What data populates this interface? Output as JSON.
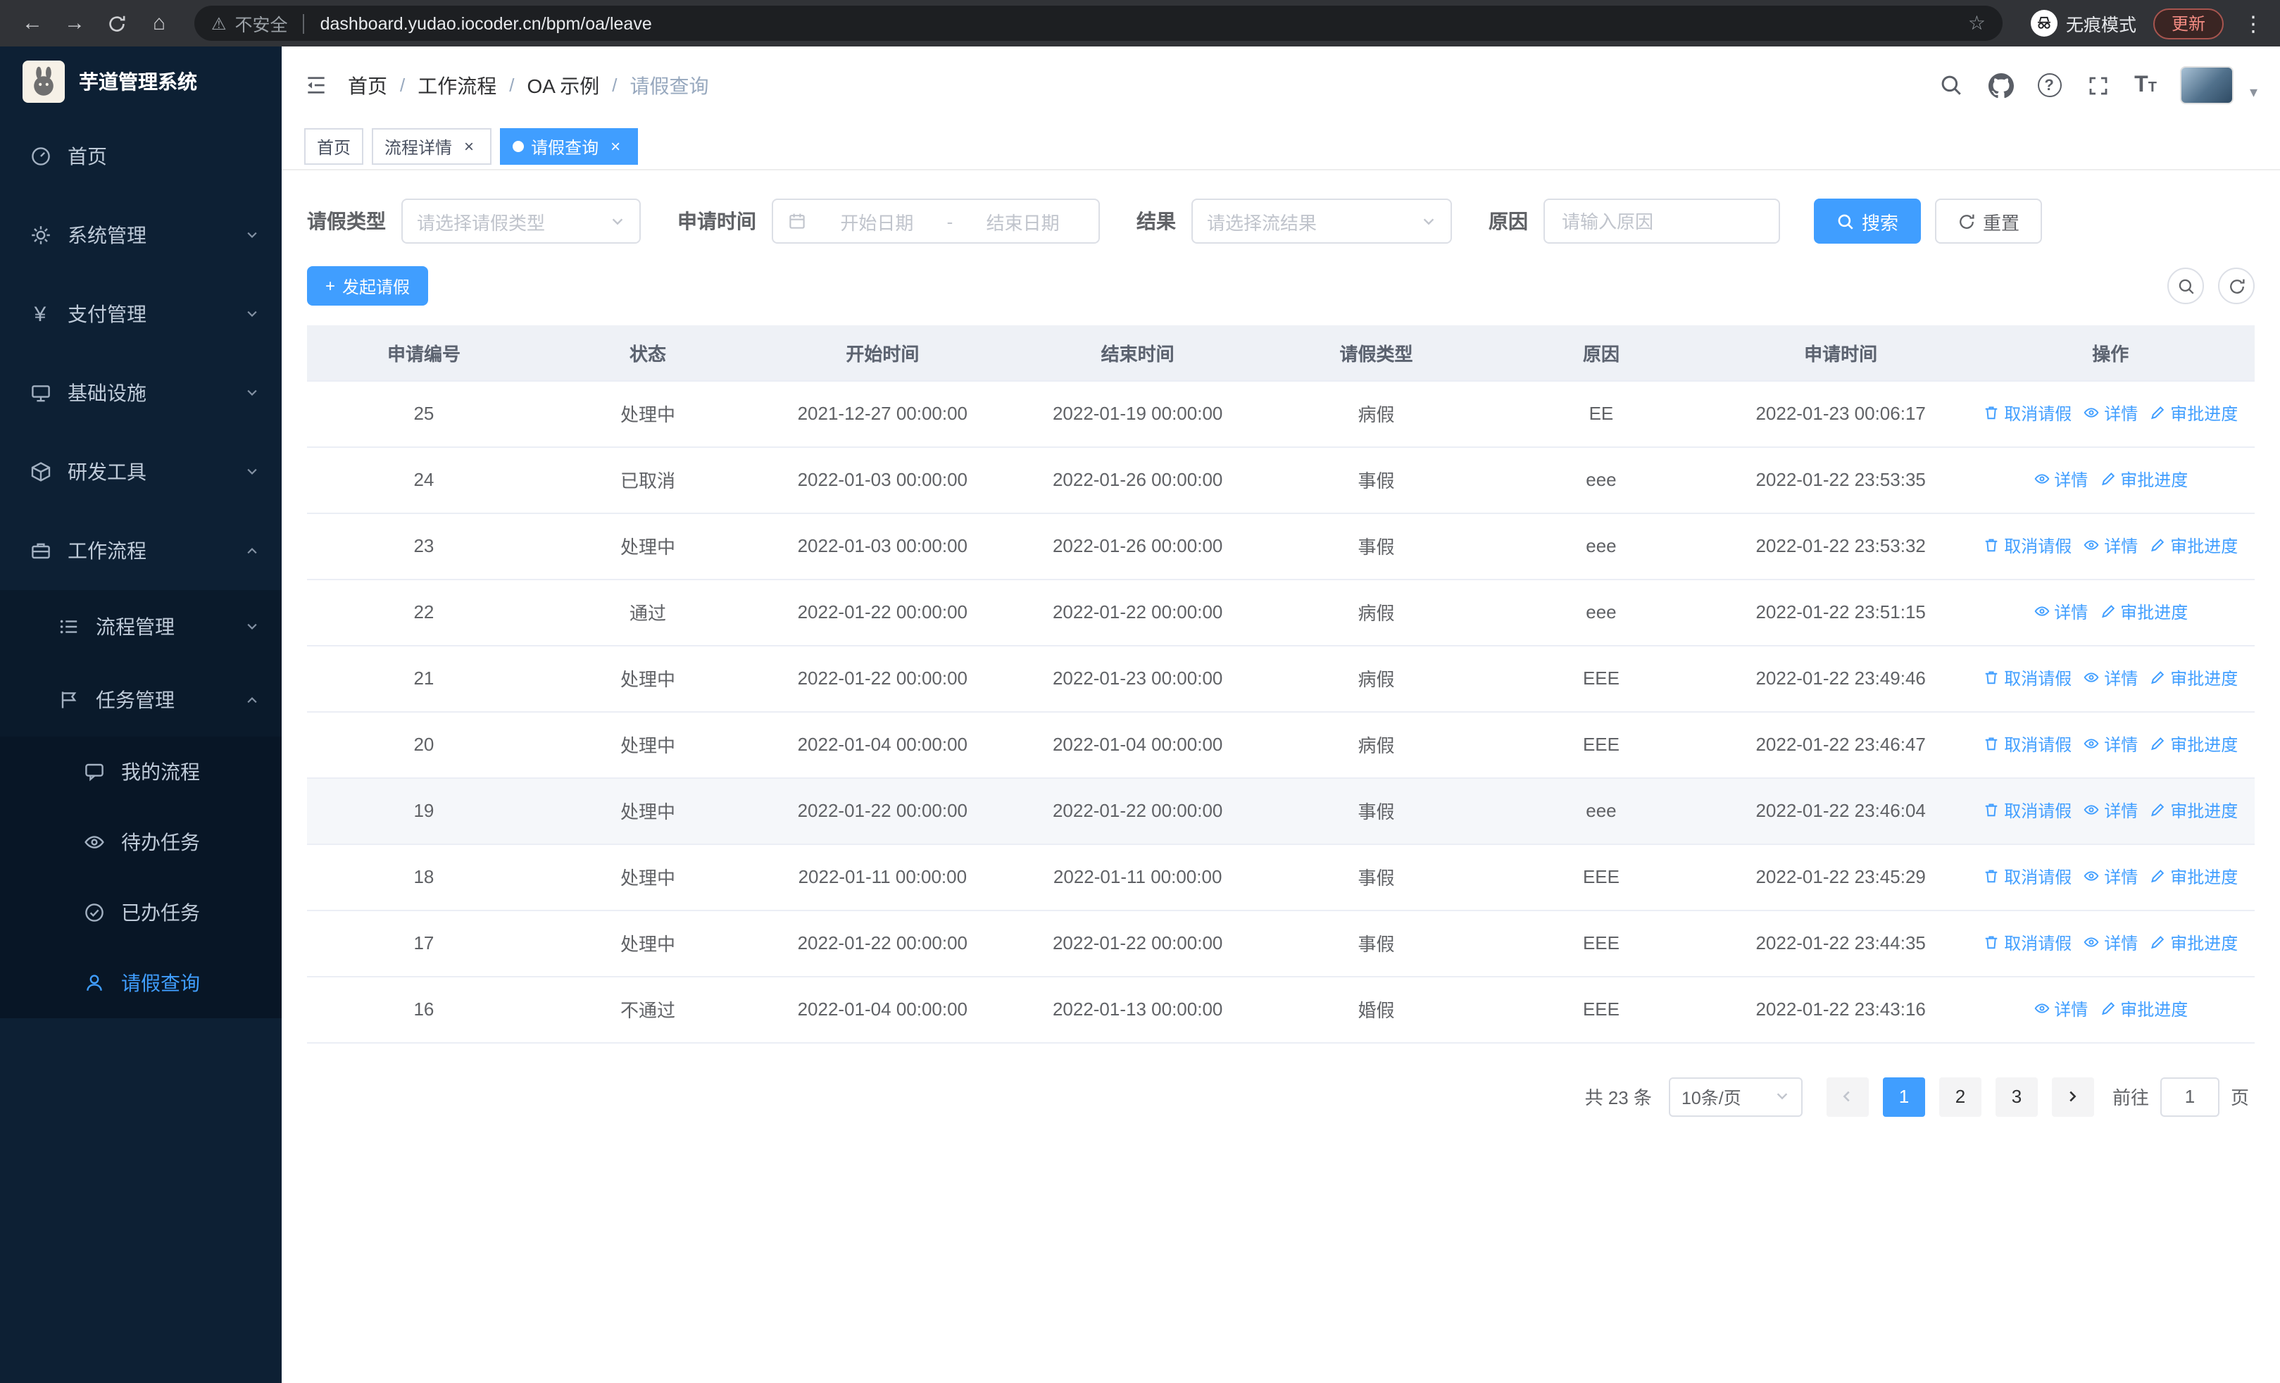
{
  "browser": {
    "security_label": "不安全",
    "url": "dashboard.yudao.iocoder.cn/bpm/oa/leave",
    "incognito_label": "无痕模式",
    "update_label": "更新"
  },
  "sidebar": {
    "app_title": "芋道管理系统",
    "items": [
      {
        "label": "首页",
        "icon": "dashboard-icon"
      },
      {
        "label": "系统管理",
        "icon": "gear-icon"
      },
      {
        "label": "支付管理",
        "icon": "yen-icon"
      },
      {
        "label": "基础设施",
        "icon": "monitor-icon"
      },
      {
        "label": "研发工具",
        "icon": "cube-icon"
      },
      {
        "label": "工作流程",
        "icon": "briefcase-icon"
      },
      {
        "label": "流程管理",
        "icon": "list-icon"
      },
      {
        "label": "任务管理",
        "icon": "flag-icon"
      },
      {
        "label": "我的流程",
        "icon": "chat-icon"
      },
      {
        "label": "待办任务",
        "icon": "eye-icon"
      },
      {
        "label": "已办任务",
        "icon": "check-circle-icon"
      },
      {
        "label": "请假查询",
        "icon": "user-icon"
      }
    ]
  },
  "header": {
    "breadcrumb": [
      "首页",
      "工作流程",
      "OA 示例",
      "请假查询"
    ],
    "separator": "/"
  },
  "tabs": [
    {
      "label": "首页"
    },
    {
      "label": "流程详情"
    },
    {
      "label": "请假查询"
    }
  ],
  "filters": {
    "leave_type_label": "请假类型",
    "leave_type_placeholder": "请选择请假类型",
    "apply_time_label": "申请时间",
    "start_date_placeholder": "开始日期",
    "range_separator": "-",
    "end_date_placeholder": "结束日期",
    "result_label": "结果",
    "result_placeholder": "请选择流结果",
    "reason_label": "原因",
    "reason_placeholder": "请输入原因",
    "search_label": "搜索",
    "reset_label": "重置"
  },
  "toolbar": {
    "create_label": "发起请假"
  },
  "table": {
    "columns": [
      "申请编号",
      "状态",
      "开始时间",
      "结束时间",
      "请假类型",
      "原因",
      "申请时间",
      "操作"
    ],
    "action_labels": {
      "cancel": "取消请假",
      "detail": "详情",
      "progress": "审批进度"
    },
    "rows": [
      {
        "id": "25",
        "status": "处理中",
        "start": "2021-12-27 00:00:00",
        "end": "2022-01-19 00:00:00",
        "type": "病假",
        "reason": "EE",
        "applied": "2022-01-23 00:06:17",
        "actions": [
          "cancel",
          "detail",
          "progress"
        ]
      },
      {
        "id": "24",
        "status": "已取消",
        "start": "2022-01-03 00:00:00",
        "end": "2022-01-26 00:00:00",
        "type": "事假",
        "reason": "eee",
        "applied": "2022-01-22 23:53:35",
        "actions": [
          "detail",
          "progress"
        ]
      },
      {
        "id": "23",
        "status": "处理中",
        "start": "2022-01-03 00:00:00",
        "end": "2022-01-26 00:00:00",
        "type": "事假",
        "reason": "eee",
        "applied": "2022-01-22 23:53:32",
        "actions": [
          "cancel",
          "detail",
          "progress"
        ]
      },
      {
        "id": "22",
        "status": "通过",
        "start": "2022-01-22 00:00:00",
        "end": "2022-01-22 00:00:00",
        "type": "病假",
        "reason": "eee",
        "applied": "2022-01-22 23:51:15",
        "actions": [
          "detail",
          "progress"
        ]
      },
      {
        "id": "21",
        "status": "处理中",
        "start": "2022-01-22 00:00:00",
        "end": "2022-01-23 00:00:00",
        "type": "病假",
        "reason": "EEE",
        "applied": "2022-01-22 23:49:46",
        "actions": [
          "cancel",
          "detail",
          "progress"
        ]
      },
      {
        "id": "20",
        "status": "处理中",
        "start": "2022-01-04 00:00:00",
        "end": "2022-01-04 00:00:00",
        "type": "病假",
        "reason": "EEE",
        "applied": "2022-01-22 23:46:47",
        "actions": [
          "cancel",
          "detail",
          "progress"
        ]
      },
      {
        "id": "19",
        "status": "处理中",
        "start": "2022-01-22 00:00:00",
        "end": "2022-01-22 00:00:00",
        "type": "事假",
        "reason": "eee",
        "applied": "2022-01-22 23:46:04",
        "actions": [
          "cancel",
          "detail",
          "progress"
        ],
        "highlighted": true
      },
      {
        "id": "18",
        "status": "处理中",
        "start": "2022-01-11 00:00:00",
        "end": "2022-01-11 00:00:00",
        "type": "事假",
        "reason": "EEE",
        "applied": "2022-01-22 23:45:29",
        "actions": [
          "cancel",
          "detail",
          "progress"
        ]
      },
      {
        "id": "17",
        "status": "处理中",
        "start": "2022-01-22 00:00:00",
        "end": "2022-01-22 00:00:00",
        "type": "事假",
        "reason": "EEE",
        "applied": "2022-01-22 23:44:35",
        "actions": [
          "cancel",
          "detail",
          "progress"
        ]
      },
      {
        "id": "16",
        "status": "不通过",
        "start": "2022-01-04 00:00:00",
        "end": "2022-01-13 00:00:00",
        "type": "婚假",
        "reason": "EEE",
        "applied": "2022-01-22 23:43:16",
        "actions": [
          "detail",
          "progress"
        ]
      }
    ]
  },
  "pagination": {
    "total_label": "共 23 条",
    "page_size_label": "10条/页",
    "pages": [
      "1",
      "2",
      "3"
    ],
    "active_page": "1",
    "goto_label": "前往",
    "goto_value": "1",
    "goto_suffix": "页"
  },
  "icons": {
    "back": "←",
    "forward": "→",
    "home": "⌂",
    "warning": "⚠",
    "star": "☆",
    "kebab": "⋮",
    "help": "?",
    "caret": "▾",
    "close": "×",
    "plus": "+",
    "font_large": "T",
    "font_small": "T",
    "yen": "¥"
  },
  "colors": {
    "accent": "#409eff",
    "sidebar_bg": "#0d2034",
    "sidebar_submenu_bg": "#0a1a2b",
    "sidebar_active_text": "#409eff",
    "chrome_bg": "#313337",
    "table_header_bg": "#eef1f6",
    "update_button_text": "#f28b82"
  }
}
